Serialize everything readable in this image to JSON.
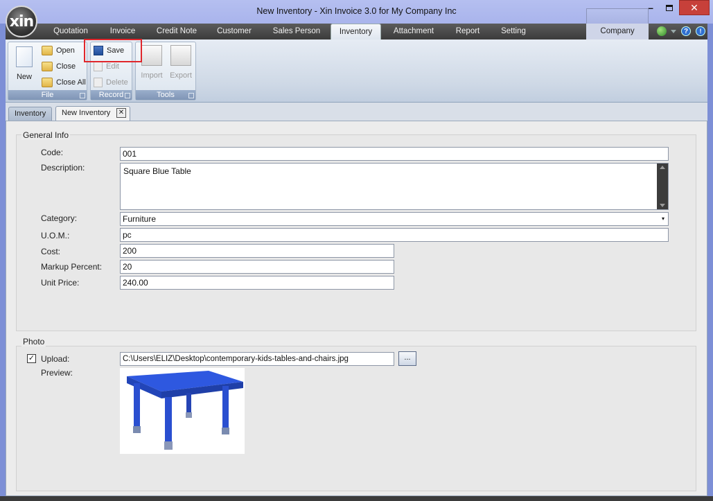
{
  "window": {
    "title": "New Inventory - Xin Invoice 3.0 for My Company Inc",
    "logo_text": "xin"
  },
  "menu": {
    "tabs": [
      "Quotation",
      "Invoice",
      "Credit Note",
      "Customer",
      "Sales Person",
      "Inventory",
      "Attachment",
      "Report",
      "Setting"
    ],
    "active_tab": "Inventory",
    "company": "Company"
  },
  "ribbon": {
    "file": {
      "label": "File",
      "new": "New",
      "open": "Open",
      "close": "Close",
      "close_all": "Close All"
    },
    "record": {
      "label": "Record",
      "save": "Save",
      "edit": "Edit",
      "delete": "Delete"
    },
    "tools": {
      "label": "Tools",
      "import": "Import",
      "export": "Export"
    }
  },
  "doc_tabs": [
    "Inventory",
    "New Inventory"
  ],
  "general_info": {
    "legend": "General Info",
    "code_label": "Code:",
    "code": "001",
    "description_label": "Description:",
    "description": "Square Blue Table",
    "category_label": "Category:",
    "category": "Furniture",
    "uom_label": "U.O.M.:",
    "uom": "pc",
    "cost_label": "Cost:",
    "cost": "200",
    "markup_label": "Markup Percent:",
    "markup": "20",
    "unit_price_label": "Unit Price:",
    "unit_price": "240.00"
  },
  "photo": {
    "legend": "Photo",
    "upload_label": "Upload:",
    "upload_checked": true,
    "path": "C:\\Users\\ELIZ\\Desktop\\contemporary-kids-tables-and-chairs.jpg",
    "browse": "...",
    "preview_label": "Preview:"
  },
  "colors": {
    "highlight": "#e0262b",
    "table_blue": "#2a4fd6"
  }
}
